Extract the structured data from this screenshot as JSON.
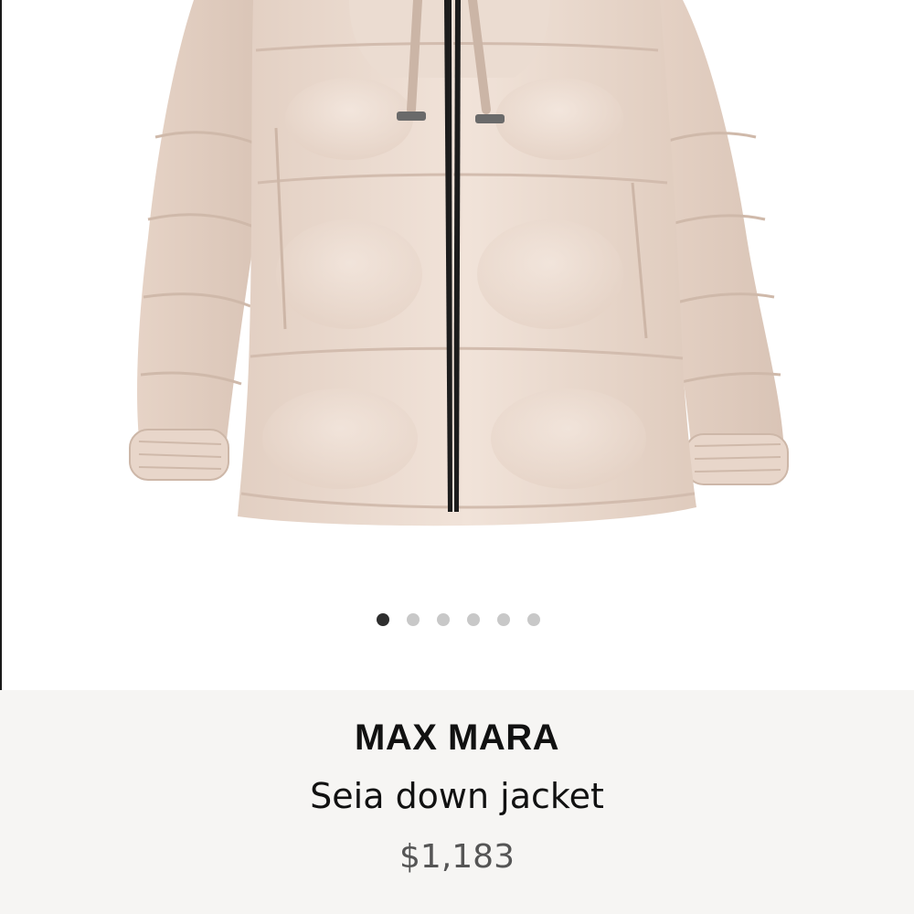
{
  "gallery": {
    "image_name": "puffer-jacket-image",
    "slide_count": 6,
    "active_slide": 1,
    "dot_active_color": "#2e2e2e",
    "dot_inactive_color": "#c8c8c8"
  },
  "product": {
    "brand": "MAX MARA",
    "name": "Seia down jacket",
    "price": "$1,183"
  },
  "colors": {
    "panel_background": "#f6f5f3",
    "jacket": "#ead9cc",
    "zipper": "#1c1c1c"
  }
}
